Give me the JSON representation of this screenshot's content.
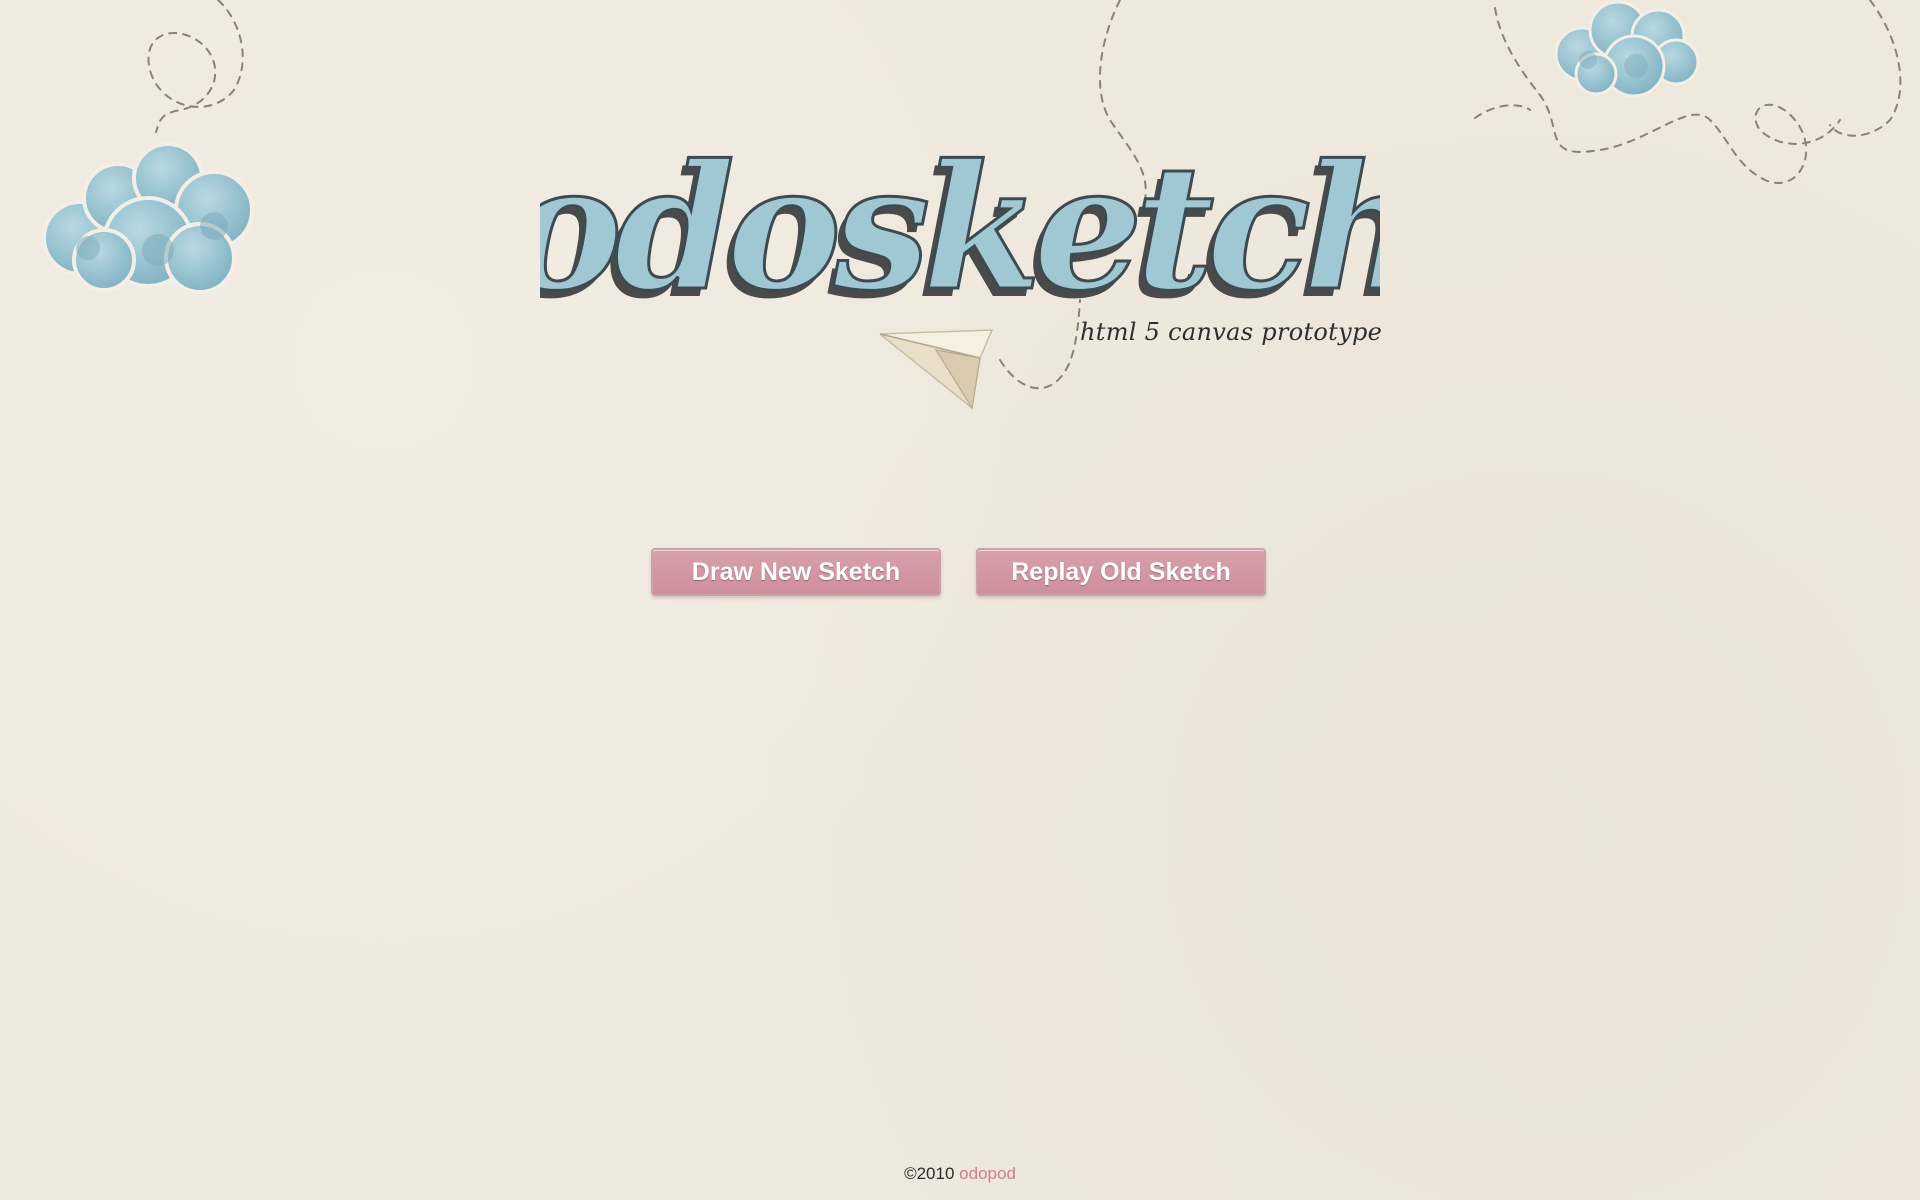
{
  "header": {
    "logo_text": "odosketch",
    "tagline": "html 5 canvas prototype"
  },
  "actions": {
    "draw_label": "Draw New Sketch",
    "replay_label": "Replay Old Sketch"
  },
  "footer": {
    "copyright": "©2010",
    "link_text": "odopod"
  },
  "colors": {
    "background": "#efe8dd",
    "cloud": "#8fbccb",
    "logo_fill": "#9fc7d4",
    "button": "#d49aa5",
    "link": "#cf7e93"
  },
  "icons": [
    "cloud-icon",
    "paper-plane-icon"
  ]
}
